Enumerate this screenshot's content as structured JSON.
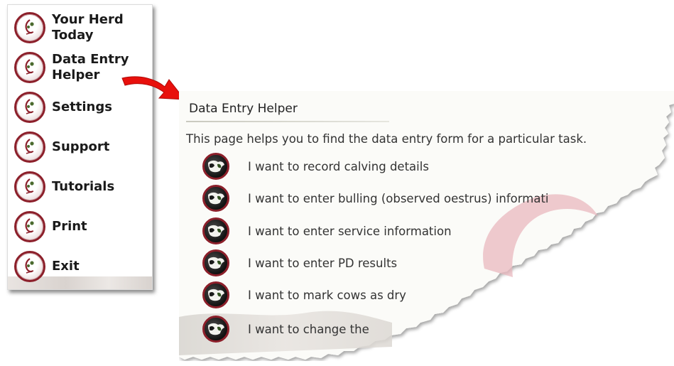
{
  "menu": {
    "items": [
      {
        "label": "Your Herd\nToday",
        "icon": "herd-logo-icon"
      },
      {
        "label": "Data Entry\nHelper",
        "icon": "herd-logo-icon"
      },
      {
        "label": "Settings",
        "icon": "herd-logo-icon"
      },
      {
        "label": "Support",
        "icon": "herd-logo-icon"
      },
      {
        "label": "Tutorials",
        "icon": "herd-logo-icon"
      },
      {
        "label": "Print",
        "icon": "herd-logo-icon"
      },
      {
        "label": "Exit",
        "icon": "herd-logo-icon"
      }
    ]
  },
  "helper": {
    "title": "Data Entry Helper",
    "description": "This page helps you to find the data entry form for a particular task.",
    "tasks": [
      {
        "label": "I want to record calving details",
        "icon": "cow-icon"
      },
      {
        "label": "I want to enter bulling (observed oestrus) informati",
        "icon": "cow-icon"
      },
      {
        "label": "I want to enter service information",
        "icon": "cow-icon"
      },
      {
        "label": "I want to enter PD results",
        "icon": "cow-icon"
      },
      {
        "label": "I want to mark cows as dry",
        "icon": "cow-icon"
      },
      {
        "label": "I want to change the",
        "icon": "cow-icon"
      }
    ]
  },
  "colors": {
    "accent": "#8c1f2a",
    "arrow": "#e8100c",
    "watermark": "#e9b8bf"
  }
}
